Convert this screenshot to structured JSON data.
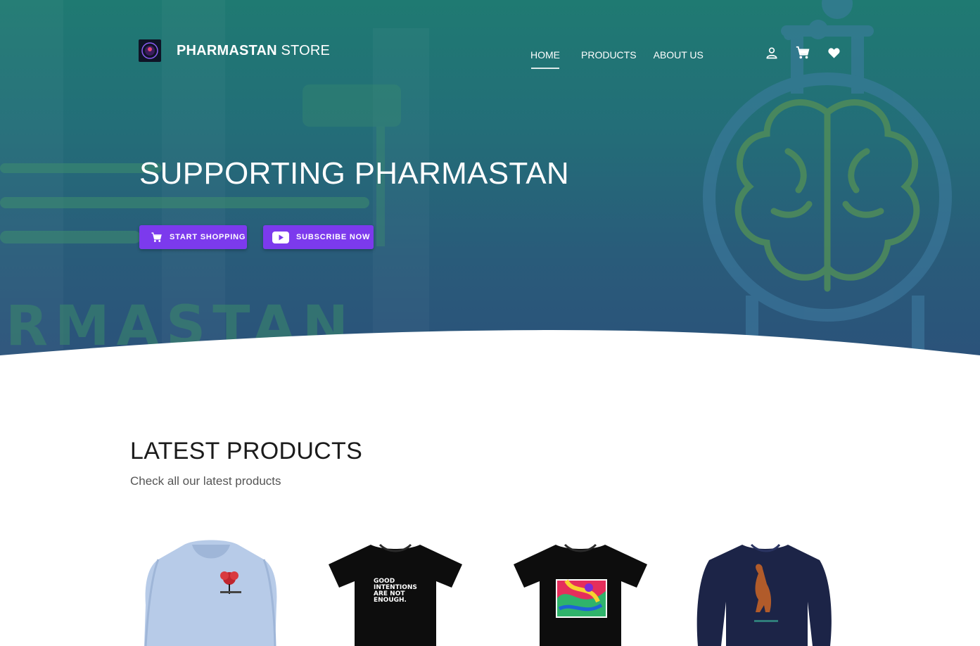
{
  "brand": {
    "bold": "PHARMASTAN",
    "light": " STORE"
  },
  "nav": {
    "items": [
      {
        "label": "HOME",
        "active": true
      },
      {
        "label": "PRODUCTS",
        "active": false
      },
      {
        "label": "ABOUT US",
        "active": false
      }
    ]
  },
  "icons": [
    "account-icon",
    "cart-icon",
    "heart-icon"
  ],
  "hero": {
    "title": "SUPPORTING PHARMASTAN",
    "background_text": "RMASTAN",
    "buttons": {
      "shop_label": "START SHOPPING",
      "subscribe_label": "SUBSCRIBE NOW"
    }
  },
  "latest": {
    "title": "LATEST PRODUCTS",
    "subtitle": "Check all our latest products"
  },
  "products": [
    {
      "type": "hoodie",
      "color": "#b7cbe8"
    },
    {
      "type": "tshirt",
      "color": "#0d0d0d",
      "print_text": "GOOD\nINTENTIONS\nARE NOT\nENOUGH."
    },
    {
      "type": "tshirt",
      "color": "#0d0d0d"
    },
    {
      "type": "longsleeve",
      "color": "#1c2447"
    }
  ],
  "colors": {
    "accent": "#7c3aed",
    "hero_top": "#1f7a72",
    "hero_bottom": "#2b527a"
  }
}
